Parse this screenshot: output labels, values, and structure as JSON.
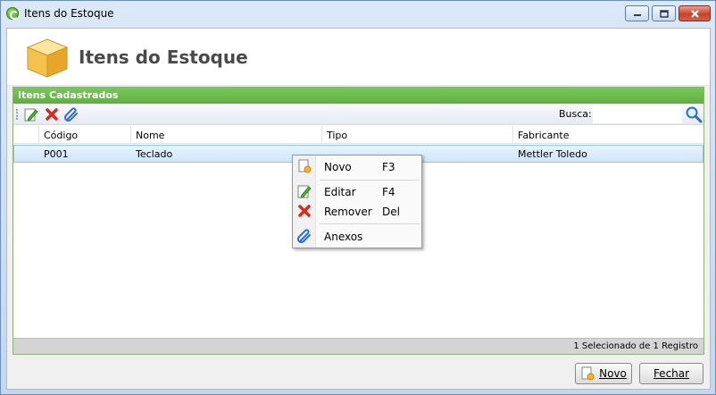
{
  "window": {
    "title": "Itens do Estoque"
  },
  "header": {
    "title": "Itens do Estoque"
  },
  "panel": {
    "title": "Itens Cadastrados"
  },
  "toolbar": {
    "search_label": "Busca:",
    "search_value": ""
  },
  "grid": {
    "columns": [
      "Código",
      "Nome",
      "Tipo",
      "Fabricante"
    ],
    "rows": [
      {
        "codigo": "P001",
        "nome": "Teclado",
        "tipo": "",
        "fabricante": "Mettler Toledo"
      }
    ]
  },
  "status": {
    "text": "1 Selecionado de 1 Registro"
  },
  "context_menu": {
    "items": [
      {
        "label": "Novo",
        "shortcut": "F3",
        "icon": "new-document-icon"
      },
      {
        "label": "Editar",
        "shortcut": "F4",
        "icon": "edit-icon"
      },
      {
        "label": "Remover",
        "shortcut": "Del",
        "icon": "remove-icon"
      },
      {
        "label": "Anexos",
        "shortcut": "",
        "icon": "paperclip-icon"
      }
    ]
  },
  "buttons": {
    "novo": "Novo",
    "fechar": "Fechar"
  },
  "colors": {
    "accent_green": "#6ab94a",
    "selection_blue": "#cfe7fa"
  }
}
